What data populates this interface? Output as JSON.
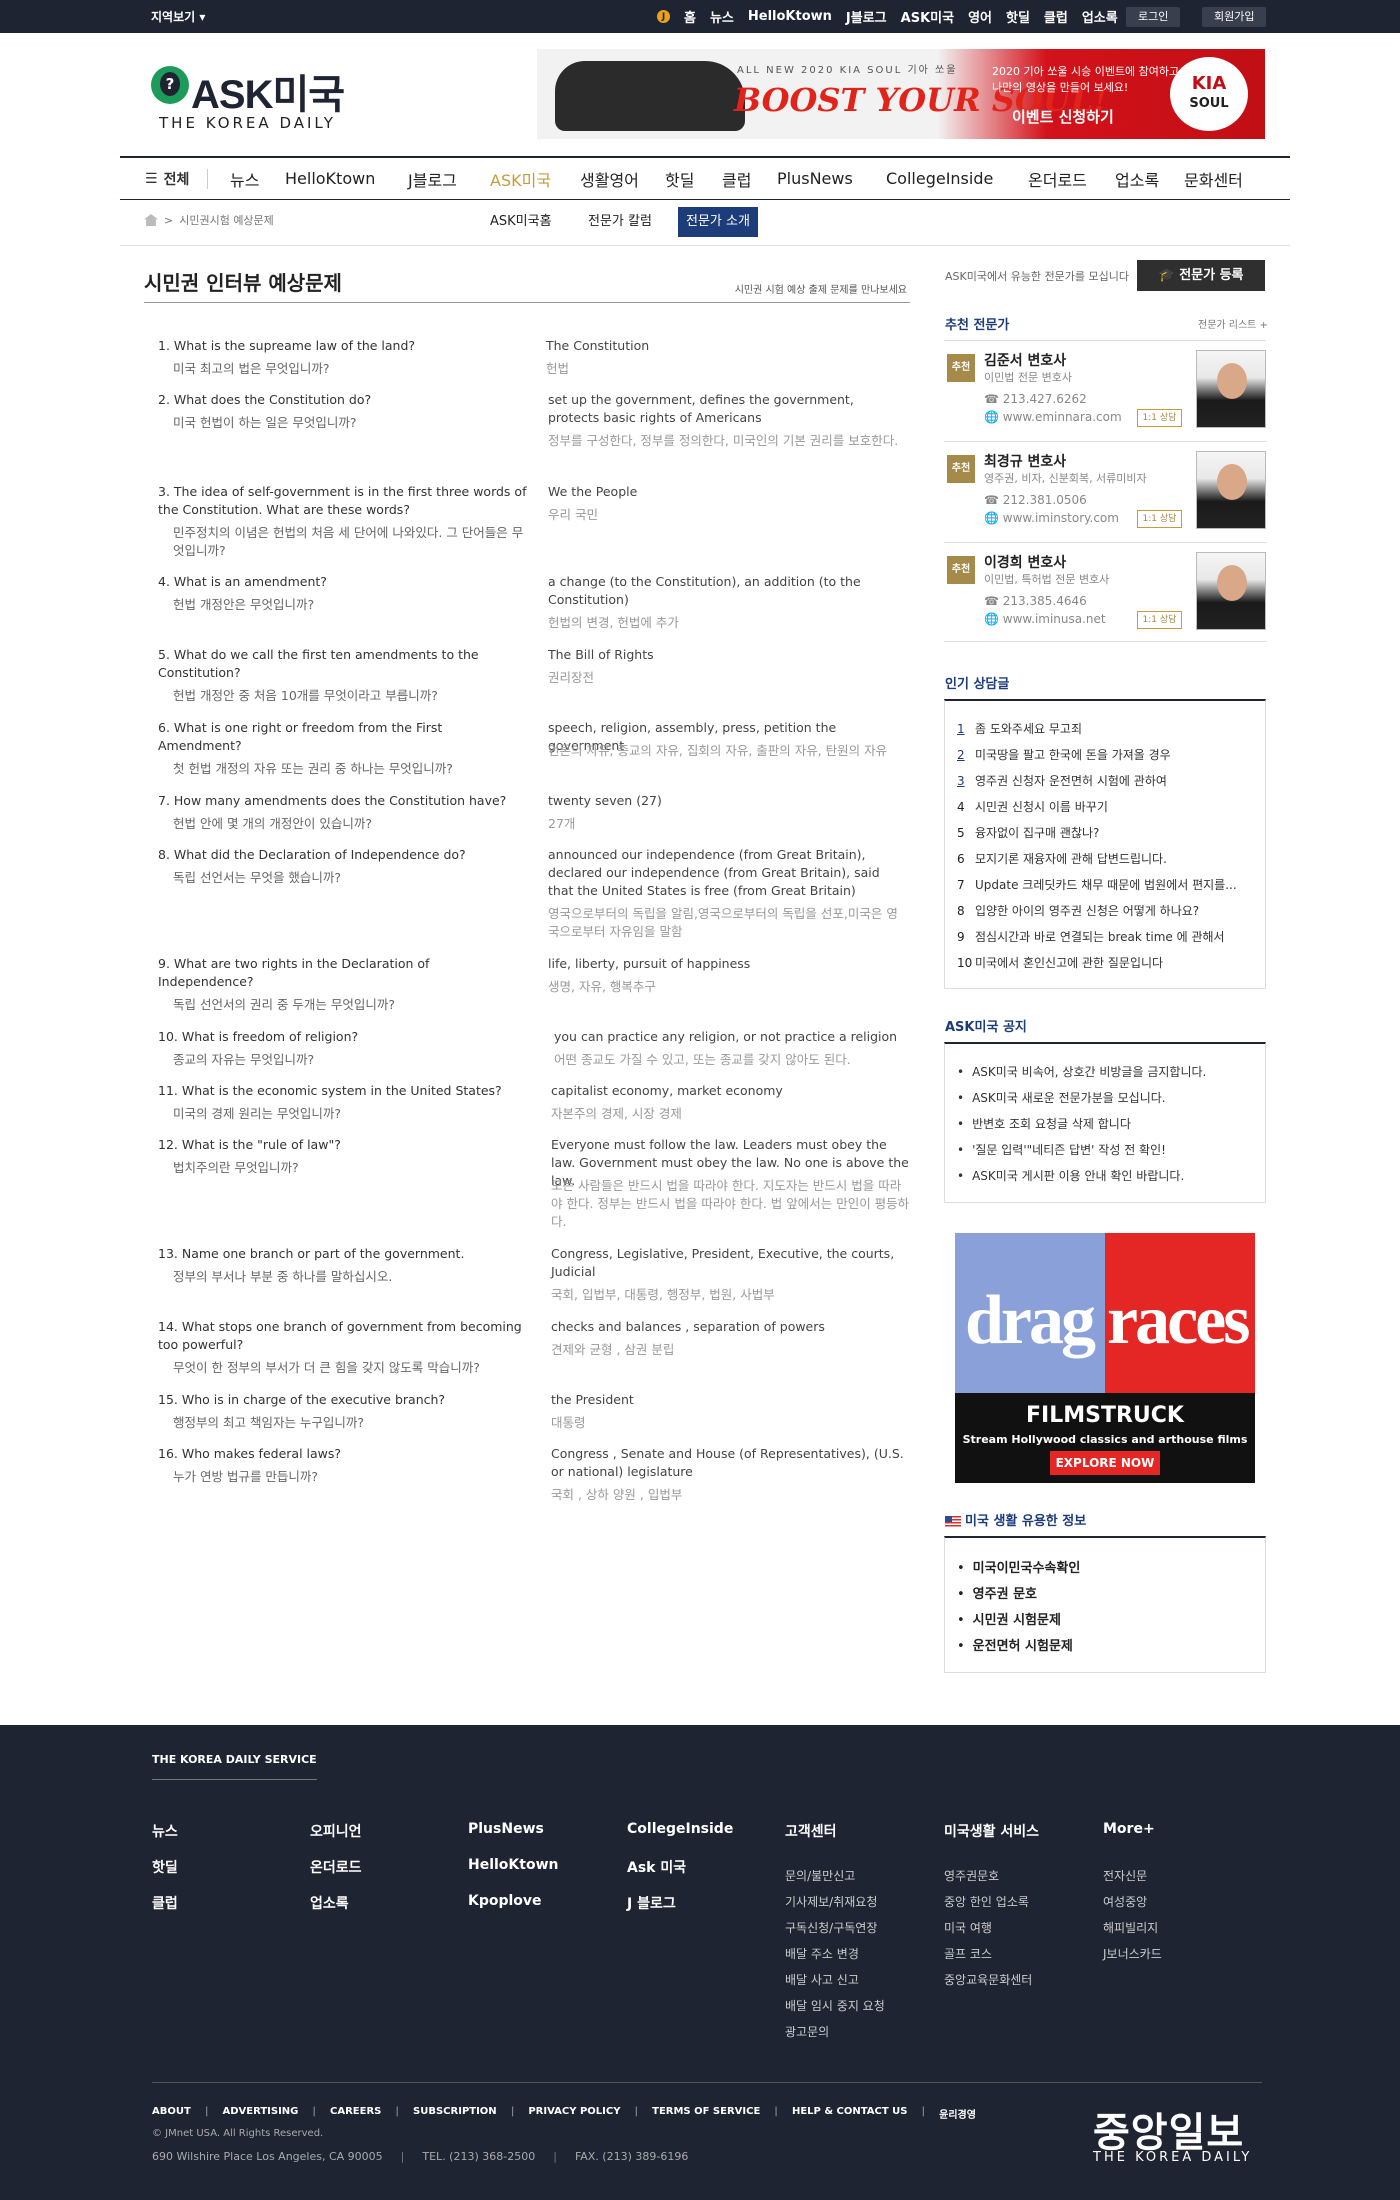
{
  "topbar": {
    "region": "지역보기",
    "links": [
      "홈",
      "뉴스",
      "HelloKtown",
      "J블로그",
      "ASK미국",
      "영어",
      "핫딜",
      "클럽",
      "업소록"
    ],
    "login": "로그인",
    "signup": "회원가입"
  },
  "logo": {
    "name": "ASK미국",
    "sub": "THE KOREA DAILY"
  },
  "banner": {
    "small": "ALL NEW 2020 KIA SOUL 기아 쏘울",
    "slogan": "BOOST YOUR SOUL!",
    "text": "2020 기아 쏘울 시승 이벤트에 참여하고 나만의 영상을 만들어 보세요!",
    "cta": "이벤트 신청하기",
    "brand": "KIA",
    "model": "SOUL"
  },
  "mainnav": {
    "all": "전체",
    "items": [
      "뉴스",
      "HelloKtown",
      "J블로그",
      "ASK미국",
      "생활영어",
      "핫딜",
      "클럽",
      "PlusNews",
      "CollegeInside",
      "온더로드",
      "업소록",
      "문화센터"
    ]
  },
  "breadcrumb": "시민권시험 예상문제",
  "subtabs": [
    "ASK미국홈",
    "전문가 칼럼",
    "전문가 소개"
  ],
  "page": {
    "title": "시민권 인터뷰 예상문제",
    "desc": "시민권 시험 예상 출제 문제를 만나보세요"
  },
  "questions": [
    {
      "q": "1. What is the supreame law of the land?",
      "qk": "미국 최고의 법은 무엇입니까?",
      "a": "The Constitution",
      "ak": "헌법"
    },
    {
      "q": "2. What does the Constitution do?",
      "qk": "미국 헌법이 하는 일은 무엇입니까?",
      "a": "set up the government, defines the government, protects basic rights of Americans",
      "ak": "정부를 구성한다, 정부를 정의한다, 미국인의 기본 권리를 보호한다."
    },
    {
      "q": "3. The idea of self-government is in the first three words of the Constitution. What are these words?",
      "qk": "민주정치의 이념은 헌법의 처음 세 단어에 나와있다. 그 단어들은 무엇입니까?",
      "a": "We the People",
      "ak": "우리 국민"
    },
    {
      "q": "4. What is an amendment?",
      "qk": "헌법 개정안은 무엇입니까?",
      "a": "a change (to the Constitution), an addition (to the Constitution)",
      "ak": "헌법의 변경, 헌법에 추가"
    },
    {
      "q": "5. What do we call the first ten amendments to the Constitution?",
      "qk": "헌법 개정안 중 처음 10개를 무엇이라고 부릅니까?",
      "a": "The Bill of Rights",
      "ak": "권리장전"
    },
    {
      "q": "6. What is one right or freedom from the First Amendment?",
      "qk": "첫 헌법 개정의 자유 또는 권리 중 하나는 무엇입니까?",
      "a": "speech, religion, assembly, press, petition the government",
      "ak": "언론의 자유, 종교의 자유, 집회의 자유, 출판의 자유, 탄원의 자유"
    },
    {
      "q": "7. How many amendments does the Constitution have?",
      "qk": "헌법 안에 몇 개의 개정안이 있습니까?",
      "a": "twenty seven (27)",
      "ak": "27개"
    },
    {
      "q": "8. What did the Declaration of Independence do?",
      "qk": "독립 선언서는 무엇을 했습니까?",
      "a": "announced our independence (from Great Britain), declared our independence (from Great Britain), said that the United States is free (from Great Britain)",
      "ak": "영국으로부터의 독립을 알림,영국으로부터의 독립을 선포,미국은 영국으로부터 자유임을 말함"
    },
    {
      "q": "9. What are two rights in the Declaration of Independence?",
      "qk": "독립 선언서의 권리 중 두개는 무엇입니까?",
      "a": "life, liberty, pursuit of happiness",
      "ak": "생명, 자유, 행복추구"
    },
    {
      "q": "10. What is freedom of religion?",
      "qk": "종교의 자유는 무엇입니까?",
      "a": "you can practice any religion, or not practice a religion",
      "ak": "어떤 종교도 가질 수 있고, 또는 종교를 갖지 않아도 된다."
    },
    {
      "q": "11. What is the economic system in the United States?",
      "qk": "미국의 경제 원리는 무엇입니까?",
      "a": "capitalist economy, market economy",
      "ak": "자본주의 경제, 시장 경제"
    },
    {
      "q": "12. What is the \"rule of law\"?",
      "qk": "법치주의란 무엇입니까?",
      "a": "Everyone must follow the law. Leaders must obey the law. Government must obey the law. No one is above the law.",
      "ak": "모든 사람들은 반드시 법을 따라야 한다. 지도자는 반드시 법을 따라야 한다. 정부는 반드시 법을 따라야 한다. 법 앞에서는 만인이 평등하다."
    },
    {
      "q": "13. Name one branch or part of the government.",
      "qk": "정부의 부서나 부분 중 하나를 말하십시오.",
      "a": "Congress, Legislative, President, Executive, the courts, Judicial",
      "ak": "국회, 입법부, 대통령, 행정부, 법원, 사법부"
    },
    {
      "q": "14. What stops one branch of government from becoming too powerful?",
      "qk": "무엇이 한 정부의 부서가 더 큰 힘을 갖지 않도록 막습니까?",
      "a": "checks and balances , separation of powers",
      "ak": "견제와 균형 , 삼권 분립"
    },
    {
      "q": "15. Who is in charge of the executive branch?",
      "qk": "행정부의 최고 책임자는 누구입니까?",
      "a": "the President",
      "ak": "대통령"
    },
    {
      "q": "16. Who makes federal laws?",
      "qk": "누가 연방 법규를 만듭니까?",
      "a": "Congress , Senate and House (of Representatives), (U.S. or national) legislature",
      "ak": "국회 , 상하 양원 , 입법부"
    }
  ],
  "sidebar": {
    "recruit_text": "ASK미국에서 유능한 전문가를 모십니다",
    "recruit_btn": "전문가 등록",
    "experts_title": "추천 전문가",
    "experts_more": "전문가 리스트 +",
    "experts": [
      {
        "tag": "추천",
        "name": "김준서 변호사",
        "spec": "이민법 전문 변호사",
        "phone": "213.427.6262",
        "web": "www.eminnara.com",
        "btn": "1:1 상담"
      },
      {
        "tag": "추천",
        "name": "최경규 변호사",
        "spec": "영주권, 비자, 신분회복, 서류미비자",
        "phone": "212.381.0506",
        "web": "www.iminstory.com",
        "btn": "1:1 상담"
      },
      {
        "tag": "추천",
        "name": "이경희 변호사",
        "spec": "이민법, 특허법 전문 변호사",
        "phone": "213.385.4646",
        "web": "www.iminusa.net",
        "btn": "1:1 상담"
      }
    ],
    "popular_title": "인기 상담글",
    "popular": [
      "좀 도와주세요 무고죄",
      "미국땅을 팔고 한국에 돈을 가져올 경우",
      "영주권 신청자 운전면허 시험에 관하여",
      "시민권 신청시 이름 바꾸기",
      "융자없이 집구매 괜찮나?",
      "모지기론 재융자에 관해 답변드립니다.",
      "Update 크레딧카드 채무 때문에 법원에서 편지를...",
      "입양한 아이의 영주권 신청은 어떻게 하나요?",
      "점심시간과 바로 연결되는 break time 에 관해서",
      "미국에서 혼인신고에 관한 질문입니다"
    ],
    "notice_title": "ASK미국 공지",
    "notices": [
      "ASK미국 비속어, 상호간 비방글을 금지합니다.",
      "ASK미국 새로운 전문가분을 모십니다.",
      "반변호 조회 요청글 삭제 합니다",
      "'질문 입력'\"네티즌 답변' 작성 전 확인!",
      "ASK미국 게시판 이용 안내 확인 바랍니다."
    ],
    "ad": {
      "w1": "drag",
      "w2": "races",
      "brand": "FILMSTRUCK",
      "tagline": "Stream Hollywood classics and arthouse films",
      "cta": "EXPLORE NOW"
    },
    "info_title": "미국 생활 유용한 정보",
    "info": [
      "미국이민국수속확인",
      "영주권 문호",
      "시민권 시험문제",
      "운전면허 시험문제"
    ]
  },
  "footer": {
    "service": "THE KOREA DAILY SERVICE",
    "col1": [
      "뉴스",
      "핫딜",
      "클럽"
    ],
    "col2": [
      "오피니언",
      "온더로드",
      "업소록"
    ],
    "col3": [
      "PlusNews",
      "HelloKtown",
      "Kpoplove"
    ],
    "col4": [
      "CollegeInside",
      "Ask 미국",
      "J 블로그"
    ],
    "cs_title": "고객센터",
    "cs": [
      "문의/불만신고",
      "기사제보/취재요청",
      "구독신청/구독연장",
      "배달 주소 변경",
      "배달 사고 신고",
      "배달 임시 중지 요청",
      "광고문의"
    ],
    "life_title": "미국생활 서비스",
    "life": [
      "영주권문호",
      "중앙 한인 업소록",
      "미국 여행",
      "골프 코스",
      "중앙교육문화센터"
    ],
    "more_title": "More+",
    "more": [
      "전자신문",
      "여성중앙",
      "해피빌리지",
      "J보너스카드"
    ],
    "links": [
      "ABOUT",
      "ADVERTISING",
      "CAREERS",
      "SUBSCRIPTION",
      "PRIVACY POLICY",
      "TERMS OF SERVICE",
      "HELP & CONTACT US",
      "윤리경영"
    ],
    "copy": "© JMnet USA. All Rights Reserved.",
    "address": "690 Wilshire Place Los Angeles, CA 90005",
    "tel": "TEL. (213) 368-2500",
    "fax": "FAX. (213) 389-6196",
    "logo": "중앙일보",
    "logo_sub": "THE KOREA DAILY"
  }
}
